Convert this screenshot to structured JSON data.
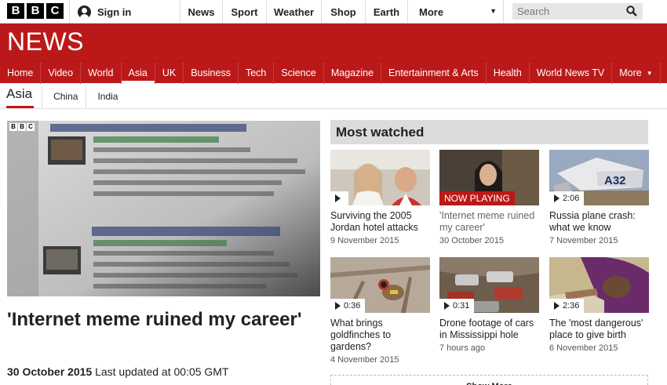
{
  "topbar": {
    "logo_letters": [
      "B",
      "B",
      "C"
    ],
    "signin_label": "Sign in",
    "nav": [
      "News",
      "Sport",
      "Weather",
      "Shop",
      "Earth",
      "More"
    ],
    "search_placeholder": "Search"
  },
  "banner": {
    "title": "NEWS"
  },
  "section_nav": {
    "items": [
      "Home",
      "Video",
      "World",
      "Asia",
      "UK",
      "Business",
      "Tech",
      "Science",
      "Magazine",
      "Entertainment & Arts",
      "Health",
      "World News TV",
      "More"
    ],
    "active": "Asia"
  },
  "sub_nav": {
    "current": "Asia",
    "items": [
      "China",
      "India"
    ]
  },
  "main_video": {
    "watermark": [
      "B",
      "B",
      "C"
    ],
    "headline": "'Internet meme ruined my career'",
    "date": "30 October 2015",
    "updated": "Last updated at 00:05 GMT"
  },
  "most_watched": {
    "title": "Most watched",
    "cards": [
      {
        "title": "Surviving the 2005 Jordan hotel attacks",
        "date": "9 November 2015",
        "duration": "",
        "now_playing": false
      },
      {
        "title": "'Internet meme ruined my career'",
        "date": "30 October 2015",
        "duration": "",
        "now_playing": true,
        "badge": "NOW PLAYING"
      },
      {
        "title": "Russia plane crash: what we know",
        "date": "7 November 2015",
        "duration": "2:06",
        "now_playing": false
      },
      {
        "title": "What brings goldfinches to gardens?",
        "date": "4 November 2015",
        "duration": "0:36",
        "now_playing": false
      },
      {
        "title": "Drone footage of cars in Mississippi hole",
        "date": "7 hours ago",
        "duration": "0:31",
        "now_playing": false
      },
      {
        "title": "The 'most dangerous' place to give birth",
        "date": "6 November 2015",
        "duration": "2:36",
        "now_playing": false
      }
    ],
    "show_more": "Show More"
  },
  "colors": {
    "brand_red": "#bb1919",
    "header_grey": "#dcdcdc"
  }
}
